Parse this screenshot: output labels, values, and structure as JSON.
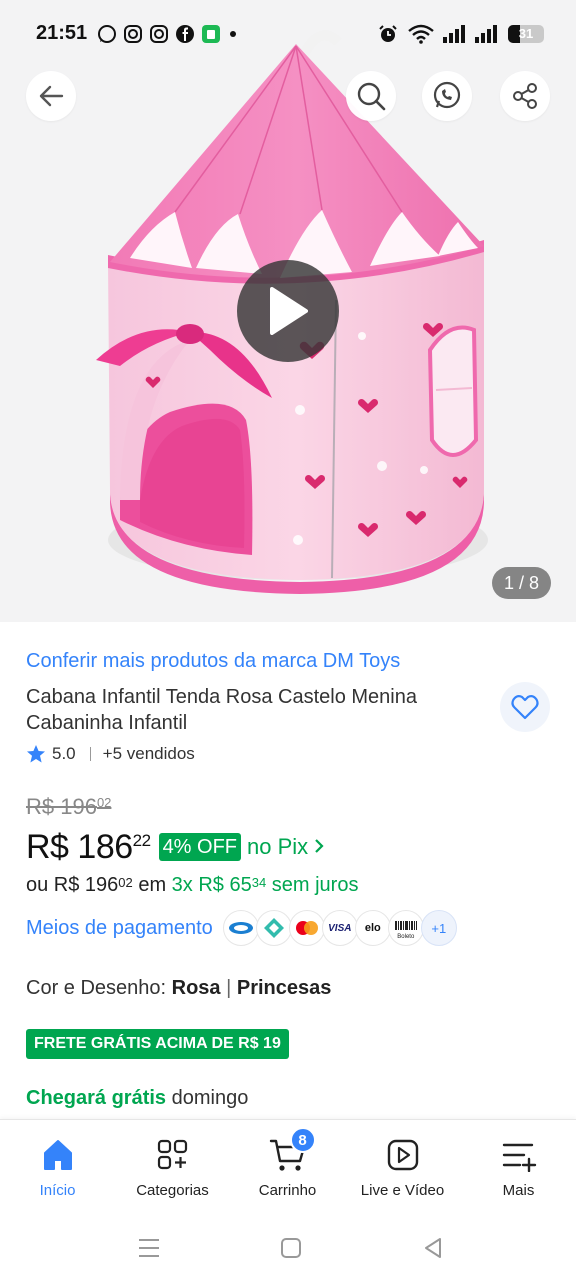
{
  "status_bar": {
    "time": "21:51",
    "battery": "31",
    "icons": [
      "whatsapp-icon",
      "instagram-icon",
      "instagram-icon",
      "facebook-icon",
      "app-icon",
      "dot-icon",
      "alarm-icon",
      "wifi-icon",
      "signal-icon",
      "signal-icon",
      "battery-icon"
    ]
  },
  "top_bar": {
    "back_icon": "arrow-left-icon",
    "search_icon": "search-icon",
    "whatsapp_share_icon": "whatsapp-icon",
    "share_icon": "share-icon"
  },
  "gallery": {
    "counter": "1 / 8",
    "play_icon": "play-icon"
  },
  "product": {
    "brand_link": "Conferir mais produtos da marca DM Toys",
    "title": "Cabana Infantil Tenda Rosa Castelo Menina Cabaninha Infantil",
    "rating": "5.0",
    "sold": "+5 vendidos",
    "old_price_int": "R$ 196",
    "old_price_cents": "02",
    "price_int": "R$ 186",
    "price_cents": "22",
    "discount": "4% OFF",
    "pix_link": "no Pix",
    "installments": {
      "prefix": "ou R$ 196",
      "prefix_cents": "02",
      "mid": " em ",
      "green_int": "3x R$ 65",
      "green_cents": "34",
      "green_suffix": " sem juros"
    },
    "payment_label": "Meios de pagamento",
    "payment_methods": [
      "Caixa",
      "Pix",
      "Mastercard",
      "VISA",
      "elo",
      "Boleto"
    ],
    "payment_more": "+1",
    "variant_label": "Cor e Desenho:",
    "variant_color": "Rosa",
    "variant_sep": "|",
    "variant_design": "Princesas",
    "free_shipping": "FRETE GRÁTIS ACIMA DE R$ 19",
    "delivery_green": "Chegará grátis",
    "delivery_day": "domingo"
  },
  "bottom_nav": {
    "items": [
      {
        "label": "Início",
        "icon": "home-icon"
      },
      {
        "label": "Categorias",
        "icon": "categories-icon"
      },
      {
        "label": "Carrinho",
        "icon": "cart-icon"
      },
      {
        "label": "Live e Vídeo",
        "icon": "video-icon"
      },
      {
        "label": "Mais",
        "icon": "menu-icon"
      }
    ],
    "cart_count": "8"
  },
  "colors": {
    "accent": "#3483fa",
    "green": "#00a650",
    "tent_pink": "#f07ab8"
  }
}
